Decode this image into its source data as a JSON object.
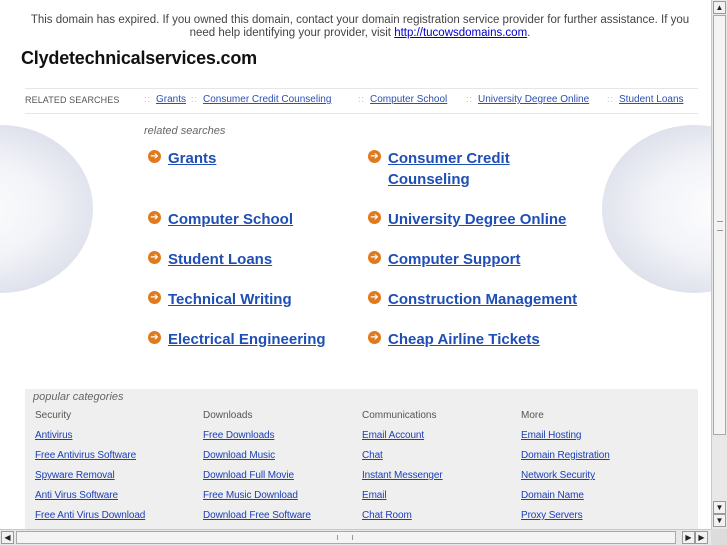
{
  "notice": {
    "text": "This domain has expired. If you owned this domain, contact your domain registration service provider for further assistance. If you need help identifying your provider, visit ",
    "link": "http://tucowsdomains.com",
    "suffix": "."
  },
  "domain_title": "Clydetechnicalservices.com",
  "related_bar": {
    "label": "RELATED SEARCHES",
    "separator": "::",
    "items": [
      "Grants",
      "Consumer Credit Counseling",
      "Computer School",
      "University Degree Online",
      "Student Loans"
    ]
  },
  "related_searches": {
    "caption": "related searches",
    "arrow_glyph": "➔",
    "items": [
      "Grants",
      "Consumer Credit Counseling",
      "Computer School",
      "University Degree Online",
      "Student Loans",
      "Computer Support",
      "Technical Writing",
      "Construction Management",
      "Electrical Engineering",
      "Cheap Airline Tickets"
    ]
  },
  "popular_categories": {
    "caption": "popular categories",
    "columns": [
      {
        "heading": "Security",
        "links": [
          "Antivirus",
          "Free Antivirus Software",
          "Spyware Removal",
          "Anti Virus Software",
          "Free Anti Virus Download"
        ]
      },
      {
        "heading": "Downloads",
        "links": [
          "Free Downloads",
          "Download Music",
          "Download Full Movie",
          "Free Music Download",
          "Download Free Software"
        ]
      },
      {
        "heading": "Communications",
        "links": [
          "Email Account",
          "Chat",
          "Instant Messenger",
          "Email",
          "Chat Room"
        ]
      },
      {
        "heading": "More",
        "links": [
          "Email Hosting",
          "Domain Registration",
          "Network Security",
          "Domain Name",
          "Proxy Servers"
        ]
      }
    ]
  },
  "scrollbars": {
    "up": "▲",
    "down": "▼",
    "down2": "▼",
    "left": "◀",
    "right": "▶",
    "right2": "▶"
  },
  "colors": {
    "link": "#1f4fb5",
    "arrow": "#e07a1e",
    "panel": "#efefef"
  }
}
